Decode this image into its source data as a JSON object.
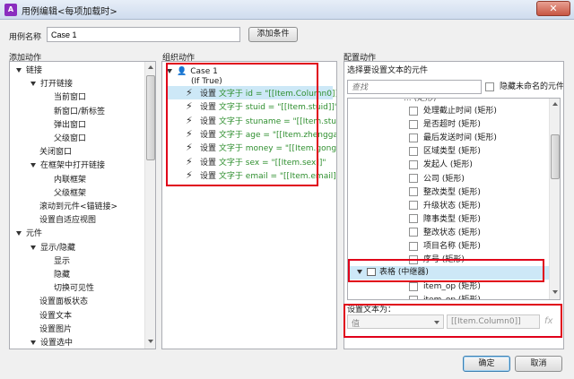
{
  "window": {
    "title": "用例编辑<每项加载时>",
    "close_glyph": "✕",
    "icon_glyph": "A"
  },
  "case_name": {
    "label": "用例名称",
    "value": "Case 1"
  },
  "add_condition_label": "添加条件",
  "sections": {
    "add_action": "添加动作",
    "organize_action": "组织动作",
    "configure_action": "配置动作"
  },
  "actions_tree": [
    {
      "label": "链接",
      "level": 0,
      "expanded": true
    },
    {
      "label": "打开链接",
      "level": 1,
      "expanded": true
    },
    {
      "label": "当前窗口",
      "level": 2
    },
    {
      "label": "新窗口/新标签",
      "level": 2
    },
    {
      "label": "弹出窗口",
      "level": 2
    },
    {
      "label": "父级窗口",
      "level": 2
    },
    {
      "label": "关闭窗口",
      "level": 1
    },
    {
      "label": "在框架中打开链接",
      "level": 1,
      "expanded": true
    },
    {
      "label": "内联框架",
      "level": 2
    },
    {
      "label": "父级框架",
      "level": 2
    },
    {
      "label": "滚动到元件<锚链接>",
      "level": 1
    },
    {
      "label": "设置自适应视图",
      "level": 1
    },
    {
      "label": "元件",
      "level": 0,
      "expanded": true
    },
    {
      "label": "显示/隐藏",
      "level": 1,
      "expanded": true
    },
    {
      "label": "显示",
      "level": 2
    },
    {
      "label": "隐藏",
      "level": 2
    },
    {
      "label": "切换可见性",
      "level": 2
    },
    {
      "label": "设置面板状态",
      "level": 1
    },
    {
      "label": "设置文本",
      "level": 1
    },
    {
      "label": "设置图片",
      "level": 1
    },
    {
      "label": "设置选中",
      "level": 1,
      "expanded": true
    }
  ],
  "organize": {
    "case_label": "Case 1",
    "condition": "(If True)",
    "set_word": "设置",
    "middle_word": "文字于",
    "actions": [
      {
        "field": "id",
        "value": "\"[[Item.Column0]]\""
      },
      {
        "field": "stuid",
        "value": "\"[[Item.stuid]]\""
      },
      {
        "field": "stuname",
        "value": "\"[[Item.stuname]]\""
      },
      {
        "field": "age",
        "value": "\"[[Item.zhengga]]\""
      },
      {
        "field": "money",
        "value": "\"[[Item.gongsi]]\""
      },
      {
        "field": "sex",
        "value": "\"[[Item.sex]]\""
      },
      {
        "field": "email",
        "value": "\"[[Item.email]]\""
      }
    ]
  },
  "configure": {
    "select_label": "选择要设置文本的元件",
    "search_placeholder": "查找",
    "hide_unnamed_label": "隐藏未命名的元件",
    "partial_top_label": "... (矩形)",
    "widgets": [
      "处理截止时间 (矩形)",
      "是否超时 (矩形)",
      "最后发送时间 (矩形)",
      "区域类型 (矩形)",
      "发起人 (矩形)",
      "公司 (矩形)",
      "整改类型 (矩形)",
      "升级状态 (矩形)",
      "障事类型 (矩形)",
      "整改状态 (矩形)",
      "项目名称 (矩形)",
      "序号 (矩形)"
    ],
    "repeater_label": "表格 (中继器)",
    "repeater_children": [
      "item_op (矩形)",
      "item_op (矩形)"
    ],
    "set_text_label": "设置文本为：",
    "value_select": "值",
    "value_text": "[[Item.Column0]]",
    "fx_label": "fx"
  },
  "buttons": {
    "ok": "确定",
    "cancel": "取消"
  },
  "colors": {
    "highlight_red": "#e0001a",
    "selected_row": "#cde8f7",
    "action_text": "#2f8f2f"
  }
}
